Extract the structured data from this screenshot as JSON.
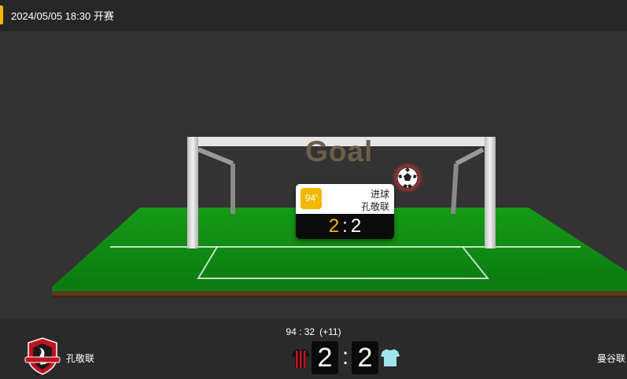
{
  "header": {
    "match_time": "2024/05/05 18:30 开赛"
  },
  "animation": {
    "title": "Goal"
  },
  "event": {
    "minute": "94'",
    "type": "进球",
    "team": "孔敬联",
    "home_score": "2",
    "away_score": "2",
    "scorer_side": "home"
  },
  "scoreboard": {
    "clock": "94 : 32",
    "added_time": "(+11)",
    "home": {
      "name": "孔敬联",
      "score": "2",
      "kit_icon": "striped-jersey-icon",
      "logo": "club-crest"
    },
    "away": {
      "name": "曼谷联",
      "score": "2",
      "kit_icon": "light-blue-jersey-icon"
    },
    "separator": ":"
  },
  "colors": {
    "accent": "#f3b800",
    "pitch": "#169a16",
    "background": "#333333",
    "home_kit": "#c1121f",
    "away_kit": "#9fe3ee"
  }
}
